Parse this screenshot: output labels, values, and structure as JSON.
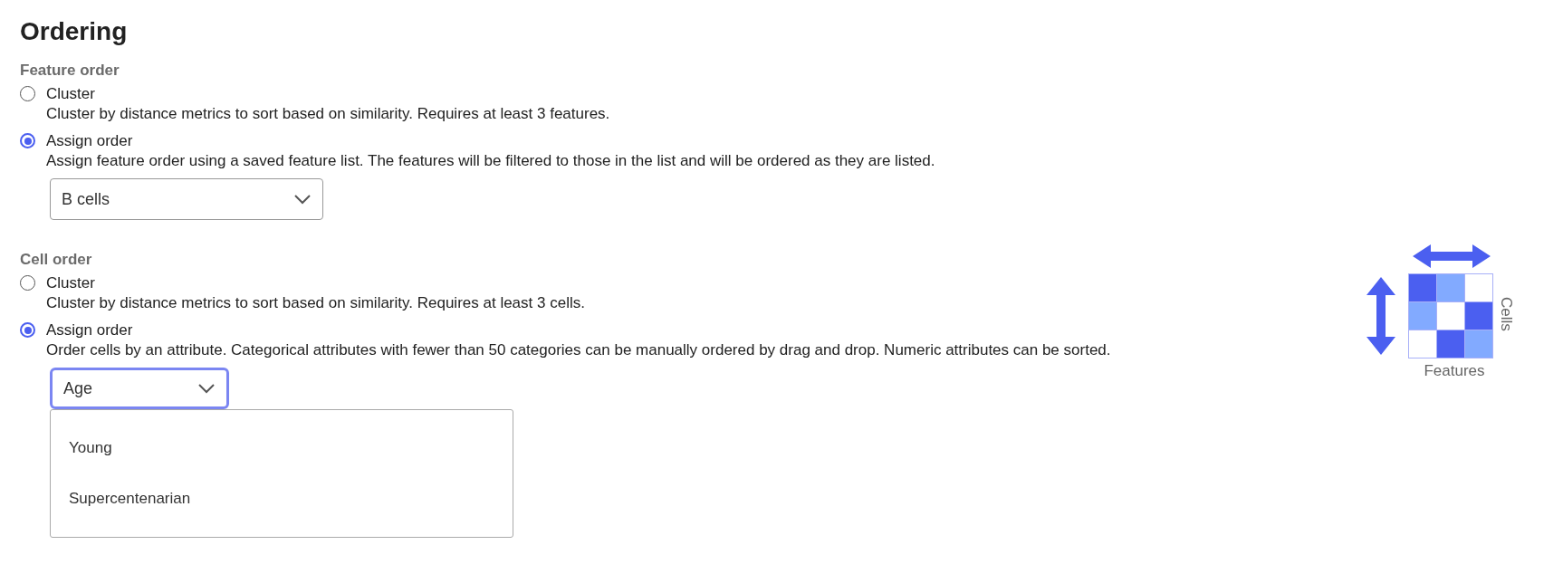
{
  "title": "Ordering",
  "sections": [
    {
      "label": "Feature order",
      "options": [
        {
          "label": "Cluster",
          "description": "Cluster by distance metrics to sort based on similarity. Requires at least 3 features.",
          "selected": false
        },
        {
          "label": "Assign order",
          "description": "Assign feature order using a saved feature list. The features will be filtered to those in the list and will be ordered as they are listed.",
          "selected": true
        }
      ],
      "select": {
        "value": "B cells",
        "focused": false
      }
    },
    {
      "label": "Cell order",
      "options": [
        {
          "label": "Cluster",
          "description": "Cluster by distance metrics to sort based on similarity. Requires at least 3 cells.",
          "selected": false
        },
        {
          "label": "Assign order",
          "description": "Order cells by an attribute. Categorical attributes with fewer than 50 categories can be manually ordered by drag and drop. Numeric attributes can be sorted.",
          "selected": true
        }
      ],
      "select": {
        "value": "Age",
        "focused": true
      },
      "menu": [
        "Young",
        "Supercentenarian"
      ]
    }
  ],
  "diagram": {
    "x_label": "Features",
    "y_label": "Cells"
  }
}
